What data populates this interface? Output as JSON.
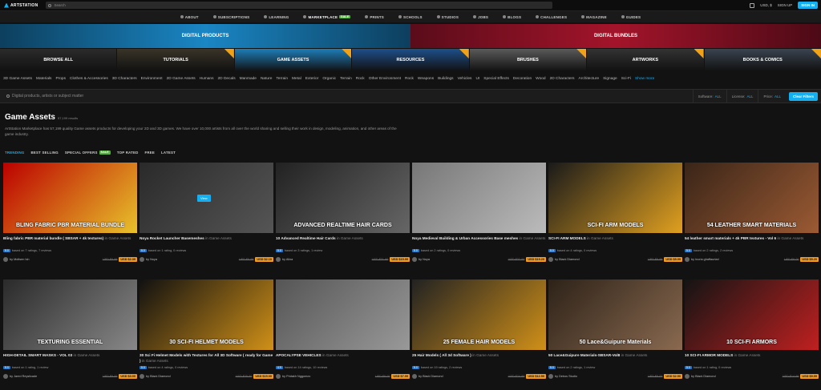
{
  "topbar": {
    "logo": "ARTSTATION",
    "search_placeholder": "Search",
    "currency": "USD, $",
    "signup": "SIGN UP",
    "signin": "SIGN IN"
  },
  "nav": [
    {
      "label": "ABOUT"
    },
    {
      "label": "SUBSCRIPTIONS"
    },
    {
      "label": "LEARNING"
    },
    {
      "label": "MARKETPLACE",
      "badge": "SALE"
    },
    {
      "label": "PRINTS"
    },
    {
      "label": "SCHOOLS"
    },
    {
      "label": "STUDIOS"
    },
    {
      "label": "JOBS"
    },
    {
      "label": "BLOGS"
    },
    {
      "label": "CHALLENGES"
    },
    {
      "label": "MAGAZINE"
    },
    {
      "label": "GUIDES"
    }
  ],
  "banners": [
    "DIGITAL PRODUCTS",
    "DIGITAL BUNDLES"
  ],
  "categories": [
    "BROWSE ALL",
    "TUTORIALS",
    "GAME ASSETS",
    "RESOURCES",
    "BRUSHES",
    "ARTWORKS",
    "BOOKS & COMICS"
  ],
  "tags": [
    "3D Game Assets",
    "Materials",
    "Props",
    "Clothes & Accessories",
    "3D Characters",
    "Environment",
    "2D Game Assets",
    "Humans",
    "2D Decals",
    "Manmade",
    "Nature",
    "Terrain",
    "Metal",
    "Exterior",
    "Organic",
    "Terrain",
    "Rock",
    "Other Environment",
    "Rock",
    "Weapons",
    "Buildings",
    "Vehicles",
    "UI",
    "Special Effects",
    "Decoration",
    "Wood",
    "2D Characters",
    "Architecture",
    "Signage",
    "Sci-Fi"
  ],
  "tags_more": "Show more",
  "filters": {
    "search_placeholder": "Digital products, artists or subject matter",
    "software_label": "Software:",
    "license_label": "License:",
    "price_label": "Price:",
    "all": "ALL",
    "clear": "Clear Filters"
  },
  "heading": {
    "title": "Game Assets",
    "count": "57,199 results",
    "description": "ArtStation Marketplace has 57,199 quality Game assets products for developing your 2D and 3D games. We have over 10,000 artists from all over the world sharing and selling their work in design, modeling, animation, and other areas of the game industry."
  },
  "sorts": [
    "TRENDING",
    "BEST SELLING",
    "SPECIAL OFFERS",
    "TOP RATED",
    "FREE",
    "LATEST"
  ],
  "sorts_badge": "SALE",
  "in_label": "in Game Assets",
  "products": [
    {
      "title": "Bling fabric PBR material bundle ( SBSAR + 4k textures)",
      "rating": "5.0",
      "reviews": "based on 7 ratings, 7 reviews",
      "author": "by Moltsen Ish",
      "old": "USD $5.99",
      "price": "USD $2.39",
      "thumb_label": "BLING FABRIC PBR MATERIAL BUNDLE",
      "colors": [
        "#b00",
        "#e8c22b"
      ]
    },
    {
      "title": "Noya Rocket Launcher Basemeshes",
      "rating": "5.0",
      "reviews": "based on 1 rating, 0 reviews",
      "author": "by Noya",
      "old": "USD $5.99",
      "price": "USD $2.10",
      "thumb_label": "",
      "view": "View",
      "colors": [
        "#2a2a2a",
        "#555"
      ]
    },
    {
      "title": "10 Advanced Realtime Hair Cards",
      "rating": "5.0",
      "reviews": "based on 3 ratings, 1 review",
      "author": "by Alina",
      "old": "USD $31.99",
      "price": "USD $15.99",
      "thumb_label": "ADVANCED REALTIME HAIR CARDS",
      "colors": [
        "#222",
        "#666"
      ]
    },
    {
      "title": "Noya Medieval Building & Urban Accessories Base meshes",
      "rating": "5.0",
      "reviews": "based on 2 ratings, 0 reviews",
      "author": "by Noya",
      "old": "USD $32.00",
      "price": "USD $19.20",
      "thumb_label": "",
      "colors": [
        "#777",
        "#bbb"
      ]
    },
    {
      "title": "SCI-FI ARM MODELS",
      "rating": "5.0",
      "reviews": "based on 4 ratings, 0 reviews",
      "author": "by Black Diamond",
      "old": "USD $9.99",
      "price": "USD $5.99",
      "thumb_label": "SCI-FI ARM MODELS",
      "colors": [
        "#1a1a1a",
        "#e0a020"
      ]
    },
    {
      "title": "54 leather smart materials + 4k PBR textures - Vol 6",
      "rating": "5.0",
      "reviews": "based on 2 ratings, 2 reviews",
      "author": "by Inoria ghaffaurtari",
      "old": "USD $8.00",
      "price": "USD $5.20",
      "thumb_label": "54 LEATHER SMART MATERIALS",
      "colors": [
        "#3a2518",
        "#9b5a33"
      ]
    },
    {
      "title": "HIGH-DETAIL SMART MASKS - VOL 03",
      "rating": "5.0",
      "reviews": "based on 1 rating, 1 review",
      "author": "by Jared Reyslicade",
      "old": "USD $5.00",
      "price": "USD $3.00",
      "thumb_label": "TEXTURING ESSENTIAL",
      "colors": [
        "#2a2a2a",
        "#888"
      ]
    },
    {
      "title": "30 Sci Fi Helmet Models with Textures for All 3D Software ( ready for Game )",
      "rating": "5.0",
      "reviews": "based on 4 ratings, 0 reviews",
      "author": "by Black Diamond",
      "old": "USD $25.00",
      "price": "USD $15.00",
      "thumb_label": "30 SCI-FI HELMET MODELS",
      "colors": [
        "#111",
        "#d09018"
      ]
    },
    {
      "title": "APOCALYPSE VEHICLES",
      "rating": "4.9",
      "reviews": "based on 14 ratings, 10 reviews",
      "author": "by Pridakh Nggomov",
      "old": "USD $9.00",
      "price": "USD $7.99",
      "thumb_label": "",
      "colors": [
        "#555",
        "#999"
      ]
    },
    {
      "title": "25 Hair Models ( All 3d Software )",
      "rating": "5.0",
      "reviews": "based on 19 ratings, 2 reviews",
      "author": "by Black Diamond",
      "old": "USD $24.99",
      "price": "USD $12.50",
      "thumb_label": "25 FEMALE HAIR MODELS",
      "colors": [
        "#222",
        "#d09018"
      ]
    },
    {
      "title": "50 Lace&Guipure Materials-SBSAR-Vol8",
      "rating": "5.0",
      "reviews": "based on 2 ratings, 1 review",
      "author": "by Debos Studio",
      "old": "USD $5.00",
      "price": "USD $2.50",
      "thumb_label": "50 Lace&Guipure Materials",
      "colors": [
        "#2d2218",
        "#8a6a50"
      ]
    },
    {
      "title": "10 SCI-FI ARMOR MODELS",
      "rating": "5.0",
      "reviews": "based on 1 rating, 0 reviews",
      "author": "by Black Diamond",
      "old": "USD $14.99",
      "price": "USD $9.99",
      "thumb_label": "10 SCI-FI ARMORS",
      "colors": [
        "#141414",
        "#c02020"
      ]
    }
  ]
}
